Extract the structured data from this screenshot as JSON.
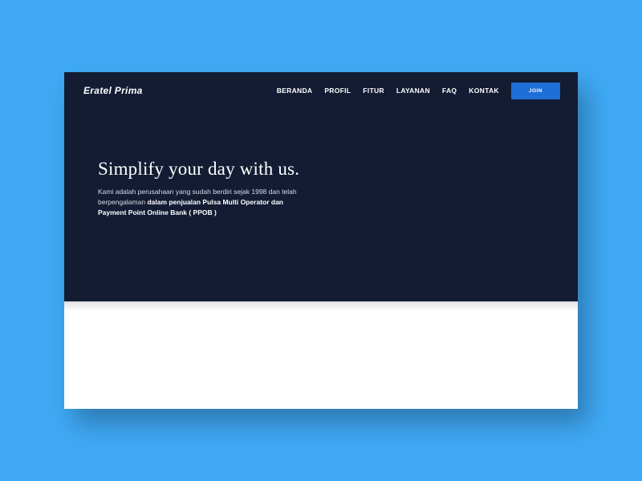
{
  "brand": "Eratel Prima",
  "nav": {
    "items": [
      {
        "label": "BERANDA"
      },
      {
        "label": "PROFIL"
      },
      {
        "label": "FITUR"
      },
      {
        "label": "LAYANAN"
      },
      {
        "label": "FAQ"
      },
      {
        "label": "KONTAK"
      }
    ],
    "join_label": "JOIN"
  },
  "hero": {
    "title": "Simplify your day with us.",
    "sub_light": "Kami adalah perusahaan yang sudah berdiri sejak 1998 dan telah berpengalaman ",
    "sub_bold": "dalam penjualan Pulsa Multi Operator dan Payment Point Online Bank ( PPOB )"
  },
  "colors": {
    "page_bg": "#3fa9f5",
    "hero_bg": "#131c33",
    "accent": "#1e6fd6"
  }
}
